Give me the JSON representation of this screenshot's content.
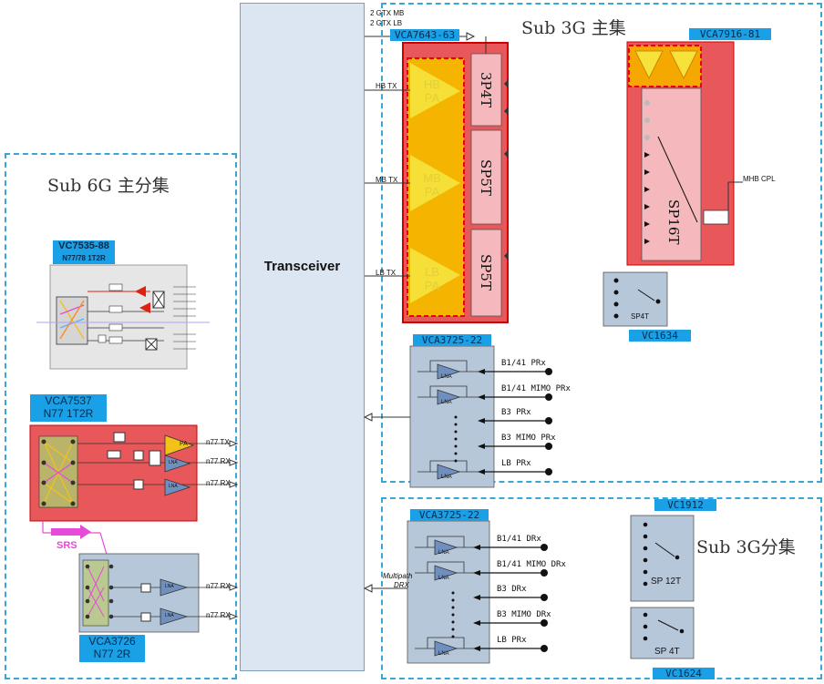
{
  "transceiver": {
    "label": "Transceiver"
  },
  "top_labels": {
    "gtx_mb": "2 GTX MB",
    "gtx_lb": "2 GTX LB"
  },
  "sub3g_main": {
    "title": "Sub 3G 主集",
    "pa_module": {
      "tag": "VCA7643-63",
      "tx_labels": [
        "HB TX",
        "MB TX",
        "LB TX"
      ],
      "pa_labels": [
        "HB\nPA",
        "MB\nPA",
        "LB\nPA"
      ],
      "switches": [
        "3P4T",
        "SP5T",
        "SP5T"
      ]
    },
    "vca7916": {
      "tag": "VCA7916-81",
      "switch": "SP16T",
      "cpl_label": "MHB CPL"
    },
    "vc1634": {
      "switch": "SP4T",
      "tag": "VC1634"
    },
    "lna_module": {
      "tag": "VCA3725-22",
      "inputs": [
        "B1/41 PRx",
        "B1/41 MIMO PRx",
        "B3 PRx",
        "B3 MIMO PRx",
        "LB PRx"
      ],
      "lna_label": "LNA"
    }
  },
  "sub3g_div": {
    "title": "Sub 3G分集",
    "lna_module": {
      "tag": "VCA3725-22",
      "inputs": [
        "B1/41 DRx",
        "B1/41 MIMO DRx",
        "B3 DRx",
        "B3 MIMO DRx",
        "LB PRx"
      ],
      "output_label_1": "Multipath",
      "output_label_2": "DRX"
    },
    "vc1912": {
      "tag": "VC1912",
      "switch": "SP 12T"
    },
    "vc1624": {
      "tag": "VC1624",
      "switch": "SP 4T"
    }
  },
  "sub6g": {
    "title": "Sub 6G 主分集",
    "vc7535": {
      "tag_line1": "VC7535-88",
      "tag_line2": "N77/78 1T2R"
    },
    "vca7537": {
      "tag_line1": "VCA7537",
      "tag_line2": "N77 1T2R",
      "tx_label": "n77 TX",
      "rx_labels": [
        "n77 RX",
        "n77 RX"
      ],
      "pa_label": "PA",
      "lna_label": "LNA"
    },
    "srs_label": "SRS",
    "vca3726": {
      "tag_line1": "VCA3726",
      "tag_line2": "N77 2R",
      "rx_labels": [
        "n77 RX",
        "n77 RX"
      ],
      "lna_label": "LNA"
    }
  },
  "colors": {
    "accent_blue": "#1aa0e6",
    "dashed": "#3aa6d8",
    "module_red": "#e8575a",
    "pa_yellow": "#f2c21b",
    "lna_panel": "#b7c7da"
  }
}
